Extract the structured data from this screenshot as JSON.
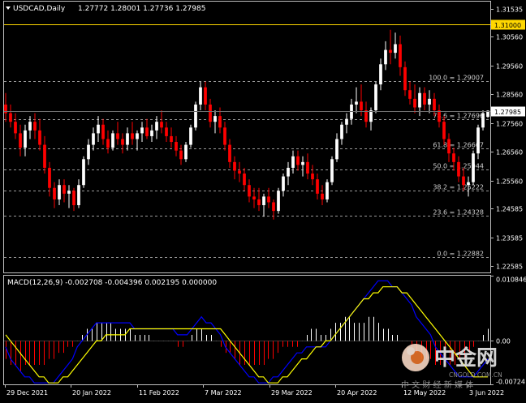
{
  "header": {
    "symbol_timeframe": "USDCAD,Daily",
    "ohlc": "1.27772 1.28001 1.27736 1.27985"
  },
  "price_axis": {
    "labels": [
      "1.31535",
      "1.30560",
      "1.29560",
      "1.28560",
      "1.27560",
      "1.26560",
      "1.25560",
      "1.24585",
      "1.23585",
      "1.22585"
    ],
    "current_price_label": "1.27985",
    "level_line_label": "1.31000"
  },
  "fibonacci": [
    {
      "label": "100.0 = 1.29007",
      "price": 1.29007
    },
    {
      "label": "78.6 = 1.27696",
      "price": 1.27696
    },
    {
      "label": "61.8 = 1.26667",
      "price": 1.26667
    },
    {
      "label": "50.0 = 1.25944",
      "price": 1.25944
    },
    {
      "label": "38.2 = 1.25222",
      "price": 1.25222
    },
    {
      "label": "23.6 = 1.24328",
      "price": 1.24328
    },
    {
      "label": "0.0 = 1.22882",
      "price": 1.22882
    }
  ],
  "macd": {
    "label": "MACD(12,26,9) -0.002708 -0.004396 0.002195 0.000000",
    "axis_labels": [
      "0.010846",
      "0.00",
      "-0.00724"
    ]
  },
  "time_axis": {
    "labels": [
      "29 Dec 2021",
      "20 Jan 2022",
      "11 Feb 2022",
      "7 Mar 2022",
      "29 Mar 2022",
      "20 Apr 2022",
      "12 May 2022",
      "3 Jun 2022"
    ]
  },
  "watermark": {
    "brand": "中金网",
    "domain": "CNGOLD.COM.CN",
    "slogan": "中 文 财 经 新 媒 体"
  },
  "colors": {
    "background": "#000000",
    "bull_candle": "#ffffff",
    "bear_candle": "#ff0000",
    "level_line": "#ffd700",
    "macd_signal": "#ffff00",
    "macd_line": "#0000ff",
    "hist_positive": "#ffffff",
    "hist_negative": "#ff0000"
  },
  "chart_data": {
    "type": "candlestick",
    "symbol": "USDCAD",
    "timeframe": "Daily",
    "ylim": [
      1.2236,
      1.3178
    ],
    "level_line": 1.31,
    "candles": [
      {
        "o": 1.282,
        "h": 1.286,
        "l": 1.276,
        "c": 1.279
      },
      {
        "o": 1.279,
        "h": 1.282,
        "l": 1.274,
        "c": 1.276
      },
      {
        "o": 1.276,
        "h": 1.279,
        "l": 1.27,
        "c": 1.272
      },
      {
        "o": 1.272,
        "h": 1.275,
        "l": 1.264,
        "c": 1.267
      },
      {
        "o": 1.267,
        "h": 1.275,
        "l": 1.264,
        "c": 1.273
      },
      {
        "o": 1.273,
        "h": 1.278,
        "l": 1.27,
        "c": 1.276
      },
      {
        "o": 1.276,
        "h": 1.279,
        "l": 1.27,
        "c": 1.273
      },
      {
        "o": 1.273,
        "h": 1.277,
        "l": 1.266,
        "c": 1.268
      },
      {
        "o": 1.268,
        "h": 1.271,
        "l": 1.258,
        "c": 1.26
      },
      {
        "o": 1.26,
        "h": 1.262,
        "l": 1.25,
        "c": 1.253
      },
      {
        "o": 1.253,
        "h": 1.255,
        "l": 1.246,
        "c": 1.249
      },
      {
        "o": 1.249,
        "h": 1.256,
        "l": 1.247,
        "c": 1.254
      },
      {
        "o": 1.254,
        "h": 1.256,
        "l": 1.248,
        "c": 1.251
      },
      {
        "o": 1.251,
        "h": 1.254,
        "l": 1.246,
        "c": 1.252
      },
      {
        "o": 1.252,
        "h": 1.253,
        "l": 1.245,
        "c": 1.247
      },
      {
        "o": 1.247,
        "h": 1.256,
        "l": 1.246,
        "c": 1.254
      },
      {
        "o": 1.254,
        "h": 1.264,
        "l": 1.253,
        "c": 1.263
      },
      {
        "o": 1.263,
        "h": 1.27,
        "l": 1.261,
        "c": 1.268
      },
      {
        "o": 1.268,
        "h": 1.274,
        "l": 1.266,
        "c": 1.272
      },
      {
        "o": 1.272,
        "h": 1.278,
        "l": 1.269,
        "c": 1.275
      },
      {
        "o": 1.275,
        "h": 1.277,
        "l": 1.268,
        "c": 1.27
      },
      {
        "o": 1.27,
        "h": 1.273,
        "l": 1.265,
        "c": 1.267
      },
      {
        "o": 1.267,
        "h": 1.273,
        "l": 1.266,
        "c": 1.272
      },
      {
        "o": 1.272,
        "h": 1.276,
        "l": 1.268,
        "c": 1.27
      },
      {
        "o": 1.27,
        "h": 1.272,
        "l": 1.265,
        "c": 1.268
      },
      {
        "o": 1.268,
        "h": 1.274,
        "l": 1.266,
        "c": 1.272
      },
      {
        "o": 1.272,
        "h": 1.276,
        "l": 1.268,
        "c": 1.27
      },
      {
        "o": 1.27,
        "h": 1.273,
        "l": 1.266,
        "c": 1.272
      },
      {
        "o": 1.272,
        "h": 1.276,
        "l": 1.269,
        "c": 1.274
      },
      {
        "o": 1.274,
        "h": 1.277,
        "l": 1.27,
        "c": 1.271
      },
      {
        "o": 1.271,
        "h": 1.275,
        "l": 1.269,
        "c": 1.273
      },
      {
        "o": 1.273,
        "h": 1.278,
        "l": 1.27,
        "c": 1.276
      },
      {
        "o": 1.276,
        "h": 1.28,
        "l": 1.272,
        "c": 1.274
      },
      {
        "o": 1.274,
        "h": 1.276,
        "l": 1.269,
        "c": 1.271
      },
      {
        "o": 1.271,
        "h": 1.274,
        "l": 1.267,
        "c": 1.269
      },
      {
        "o": 1.269,
        "h": 1.271,
        "l": 1.264,
        "c": 1.266
      },
      {
        "o": 1.266,
        "h": 1.268,
        "l": 1.261,
        "c": 1.263
      },
      {
        "o": 1.263,
        "h": 1.269,
        "l": 1.262,
        "c": 1.268
      },
      {
        "o": 1.268,
        "h": 1.275,
        "l": 1.267,
        "c": 1.274
      },
      {
        "o": 1.274,
        "h": 1.283,
        "l": 1.273,
        "c": 1.282
      },
      {
        "o": 1.282,
        "h": 1.29,
        "l": 1.28,
        "c": 1.288
      },
      {
        "o": 1.288,
        "h": 1.29,
        "l": 1.28,
        "c": 1.282
      },
      {
        "o": 1.282,
        "h": 1.284,
        "l": 1.274,
        "c": 1.276
      },
      {
        "o": 1.276,
        "h": 1.28,
        "l": 1.272,
        "c": 1.278
      },
      {
        "o": 1.278,
        "h": 1.281,
        "l": 1.272,
        "c": 1.274
      },
      {
        "o": 1.274,
        "h": 1.276,
        "l": 1.266,
        "c": 1.268
      },
      {
        "o": 1.268,
        "h": 1.27,
        "l": 1.26,
        "c": 1.262
      },
      {
        "o": 1.262,
        "h": 1.264,
        "l": 1.256,
        "c": 1.259
      },
      {
        "o": 1.259,
        "h": 1.262,
        "l": 1.255,
        "c": 1.258
      },
      {
        "o": 1.258,
        "h": 1.26,
        "l": 1.252,
        "c": 1.254
      },
      {
        "o": 1.254,
        "h": 1.256,
        "l": 1.248,
        "c": 1.25
      },
      {
        "o": 1.25,
        "h": 1.253,
        "l": 1.246,
        "c": 1.249
      },
      {
        "o": 1.249,
        "h": 1.253,
        "l": 1.245,
        "c": 1.247
      },
      {
        "o": 1.247,
        "h": 1.251,
        "l": 1.243,
        "c": 1.25
      },
      {
        "o": 1.25,
        "h": 1.253,
        "l": 1.246,
        "c": 1.248
      },
      {
        "o": 1.248,
        "h": 1.249,
        "l": 1.242,
        "c": 1.245
      },
      {
        "o": 1.245,
        "h": 1.253,
        "l": 1.244,
        "c": 1.252
      },
      {
        "o": 1.252,
        "h": 1.258,
        "l": 1.25,
        "c": 1.257
      },
      {
        "o": 1.257,
        "h": 1.262,
        "l": 1.254,
        "c": 1.26
      },
      {
        "o": 1.26,
        "h": 1.266,
        "l": 1.258,
        "c": 1.264
      },
      {
        "o": 1.264,
        "h": 1.266,
        "l": 1.259,
        "c": 1.261
      },
      {
        "o": 1.261,
        "h": 1.264,
        "l": 1.257,
        "c": 1.262
      },
      {
        "o": 1.262,
        "h": 1.265,
        "l": 1.256,
        "c": 1.258
      },
      {
        "o": 1.258,
        "h": 1.261,
        "l": 1.254,
        "c": 1.256
      },
      {
        "o": 1.256,
        "h": 1.258,
        "l": 1.249,
        "c": 1.251
      },
      {
        "o": 1.251,
        "h": 1.254,
        "l": 1.247,
        "c": 1.249
      },
      {
        "o": 1.249,
        "h": 1.256,
        "l": 1.248,
        "c": 1.255
      },
      {
        "o": 1.255,
        "h": 1.264,
        "l": 1.254,
        "c": 1.263
      },
      {
        "o": 1.263,
        "h": 1.272,
        "l": 1.262,
        "c": 1.27
      },
      {
        "o": 1.27,
        "h": 1.276,
        "l": 1.268,
        "c": 1.275
      },
      {
        "o": 1.275,
        "h": 1.279,
        "l": 1.272,
        "c": 1.277
      },
      {
        "o": 1.277,
        "h": 1.284,
        "l": 1.275,
        "c": 1.282
      },
      {
        "o": 1.282,
        "h": 1.288,
        "l": 1.279,
        "c": 1.283
      },
      {
        "o": 1.283,
        "h": 1.289,
        "l": 1.278,
        "c": 1.28
      },
      {
        "o": 1.28,
        "h": 1.283,
        "l": 1.274,
        "c": 1.276
      },
      {
        "o": 1.276,
        "h": 1.281,
        "l": 1.273,
        "c": 1.28
      },
      {
        "o": 1.28,
        "h": 1.29,
        "l": 1.279,
        "c": 1.289
      },
      {
        "o": 1.289,
        "h": 1.298,
        "l": 1.287,
        "c": 1.296
      },
      {
        "o": 1.296,
        "h": 1.304,
        "l": 1.294,
        "c": 1.301
      },
      {
        "o": 1.301,
        "h": 1.308,
        "l": 1.296,
        "c": 1.3
      },
      {
        "o": 1.3,
        "h": 1.307,
        "l": 1.298,
        "c": 1.303
      },
      {
        "o": 1.303,
        "h": 1.306,
        "l": 1.292,
        "c": 1.295
      },
      {
        "o": 1.295,
        "h": 1.297,
        "l": 1.285,
        "c": 1.287
      },
      {
        "o": 1.287,
        "h": 1.29,
        "l": 1.282,
        "c": 1.284
      },
      {
        "o": 1.284,
        "h": 1.289,
        "l": 1.279,
        "c": 1.281
      },
      {
        "o": 1.281,
        "h": 1.288,
        "l": 1.278,
        "c": 1.286
      },
      {
        "o": 1.286,
        "h": 1.288,
        "l": 1.28,
        "c": 1.282
      },
      {
        "o": 1.282,
        "h": 1.287,
        "l": 1.279,
        "c": 1.284
      },
      {
        "o": 1.284,
        "h": 1.286,
        "l": 1.278,
        "c": 1.28
      },
      {
        "o": 1.28,
        "h": 1.282,
        "l": 1.274,
        "c": 1.276
      },
      {
        "o": 1.276,
        "h": 1.278,
        "l": 1.268,
        "c": 1.27
      },
      {
        "o": 1.27,
        "h": 1.272,
        "l": 1.262,
        "c": 1.265
      },
      {
        "o": 1.265,
        "h": 1.267,
        "l": 1.259,
        "c": 1.262
      },
      {
        "o": 1.262,
        "h": 1.264,
        "l": 1.255,
        "c": 1.257
      },
      {
        "o": 1.257,
        "h": 1.26,
        "l": 1.252,
        "c": 1.254
      },
      {
        "o": 1.254,
        "h": 1.257,
        "l": 1.25,
        "c": 1.255
      },
      {
        "o": 1.255,
        "h": 1.266,
        "l": 1.254,
        "c": 1.265
      },
      {
        "o": 1.265,
        "h": 1.275,
        "l": 1.263,
        "c": 1.274
      },
      {
        "o": 1.274,
        "h": 1.28,
        "l": 1.273,
        "c": 1.279
      },
      {
        "o": 1.27772,
        "h": 1.28001,
        "l": 1.27736,
        "c": 1.27985
      }
    ],
    "macd": {
      "params": [
        12,
        26,
        9
      ],
      "values": [
        -0.002708,
        -0.004396,
        0.002195,
        0.0
      ],
      "ylim": [
        -0.00724,
        0.010846
      ],
      "histogram": [
        -0.003,
        -0.004,
        -0.004,
        -0.005,
        -0.004,
        -0.004,
        -0.004,
        -0.004,
        -0.004,
        -0.003,
        -0.003,
        -0.002,
        -0.002,
        -0.001,
        -0.001,
        0.0,
        0.001,
        0.002,
        0.002,
        0.003,
        0.003,
        0.003,
        0.003,
        0.002,
        0.002,
        0.002,
        0.002,
        0.001,
        0.001,
        0.001,
        0.001,
        0.0,
        0.0,
        0.0,
        0.0,
        0.0,
        -0.001,
        -0.001,
        0.0,
        0.001,
        0.002,
        0.002,
        0.001,
        0.001,
        0.0,
        -0.001,
        -0.002,
        -0.002,
        -0.003,
        -0.004,
        -0.004,
        -0.004,
        -0.004,
        -0.004,
        -0.004,
        -0.003,
        -0.003,
        -0.002,
        -0.001,
        -0.001,
        -0.001,
        -0.001,
        0.0,
        0.001,
        0.002,
        0.002,
        0.001,
        0.001,
        0.002,
        0.003,
        0.003,
        0.004,
        0.004,
        0.003,
        0.003,
        0.003,
        0.004,
        0.004,
        0.003,
        0.002,
        0.002,
        0.001,
        0.001,
        0.0,
        0.0,
        -0.001,
        -0.002,
        -0.003,
        -0.003,
        -0.003,
        -0.004,
        -0.004,
        -0.004,
        -0.004,
        -0.004,
        -0.003,
        -0.003,
        -0.002,
        -0.001,
        0.0,
        0.001,
        0.002
      ],
      "macd_line": [
        -0.001,
        -0.003,
        -0.004,
        -0.005,
        -0.006,
        -0.006,
        -0.007,
        -0.007,
        -0.007,
        -0.007,
        -0.007,
        -0.006,
        -0.005,
        -0.004,
        -0.003,
        -0.001,
        0.0,
        0.001,
        0.002,
        0.003,
        0.003,
        0.003,
        0.003,
        0.003,
        0.003,
        0.003,
        0.003,
        0.002,
        0.002,
        0.002,
        0.002,
        0.002,
        0.002,
        0.002,
        0.002,
        0.002,
        0.001,
        0.001,
        0.001,
        0.002,
        0.003,
        0.004,
        0.003,
        0.003,
        0.002,
        0.001,
        -0.001,
        -0.002,
        -0.003,
        -0.004,
        -0.005,
        -0.006,
        -0.006,
        -0.007,
        -0.007,
        -0.007,
        -0.006,
        -0.006,
        -0.005,
        -0.004,
        -0.003,
        -0.002,
        -0.002,
        -0.001,
        -0.001,
        -0.001,
        -0.001,
        -0.001,
        0.0,
        0.001,
        0.002,
        0.003,
        0.004,
        0.005,
        0.006,
        0.007,
        0.008,
        0.009,
        0.01,
        0.01,
        0.01,
        0.009,
        0.009,
        0.008,
        0.007,
        0.006,
        0.004,
        0.003,
        0.002,
        0.001,
        -0.001,
        -0.002,
        -0.003,
        -0.004,
        -0.005,
        -0.006,
        -0.006,
        -0.006,
        -0.006,
        -0.005,
        -0.004,
        -0.003
      ],
      "signal_line": [
        0.001,
        0.0,
        -0.001,
        -0.002,
        -0.003,
        -0.004,
        -0.005,
        -0.006,
        -0.006,
        -0.007,
        -0.007,
        -0.007,
        -0.006,
        -0.006,
        -0.005,
        -0.004,
        -0.003,
        -0.002,
        -0.001,
        0.0,
        0.0,
        0.001,
        0.001,
        0.001,
        0.001,
        0.001,
        0.002,
        0.002,
        0.002,
        0.002,
        0.002,
        0.002,
        0.002,
        0.002,
        0.002,
        0.002,
        0.002,
        0.002,
        0.002,
        0.002,
        0.002,
        0.002,
        0.002,
        0.002,
        0.002,
        0.002,
        0.001,
        0.0,
        -0.001,
        -0.002,
        -0.003,
        -0.004,
        -0.005,
        -0.006,
        -0.006,
        -0.007,
        -0.007,
        -0.007,
        -0.006,
        -0.006,
        -0.005,
        -0.004,
        -0.003,
        -0.003,
        -0.002,
        -0.001,
        -0.001,
        0.0,
        0.0,
        0.001,
        0.002,
        0.003,
        0.004,
        0.005,
        0.006,
        0.007,
        0.007,
        0.008,
        0.008,
        0.009,
        0.009,
        0.009,
        0.009,
        0.008,
        0.008,
        0.007,
        0.006,
        0.005,
        0.004,
        0.003,
        0.002,
        0.001,
        0.0,
        -0.001,
        -0.002,
        -0.003,
        -0.004,
        -0.005,
        -0.006,
        -0.006,
        -0.006,
        -0.006
      ]
    }
  }
}
